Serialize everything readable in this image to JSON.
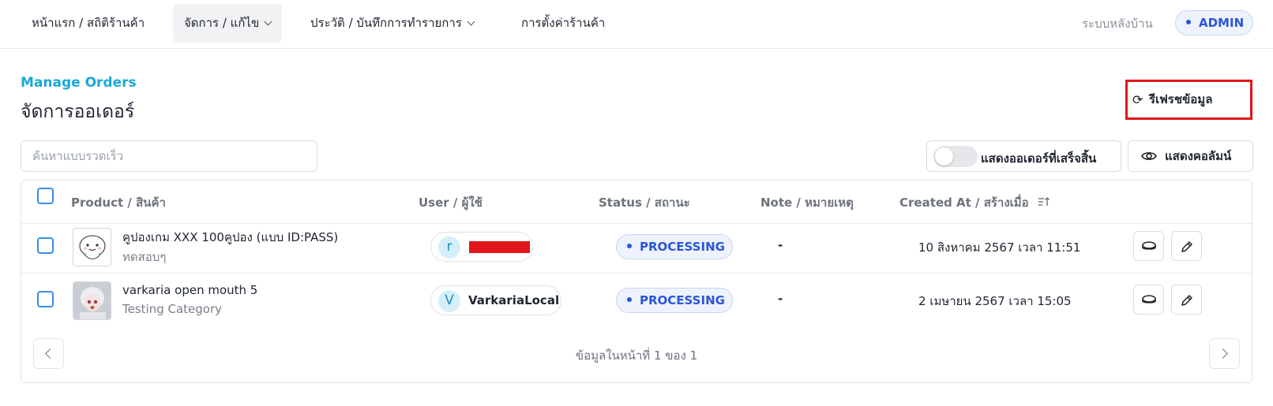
{
  "nav": {
    "home": "หน้าแรก / สถิติร้านค้า",
    "manage": "จัดการ / แก้ไข",
    "history": "ประวัติ / บันทึกการทำรายการ",
    "settings": "การตั้งค่าร้านค้า",
    "backend": "ระบบหลังบ้าน",
    "role": "ADMIN"
  },
  "page": {
    "title_en": "Manage Orders",
    "title_th": "จัดการออเดอร์",
    "refresh_label": "รีเฟรชข้อมูล",
    "search_placeholder": "ค้นหาแบบรวดเร็ว",
    "toggle_label": "แสดงออเดอร์ที่เสร็จสิ้น",
    "toggle_on": false,
    "columns_label": "แสดงคอลัมน์"
  },
  "table": {
    "headers": {
      "product": "Product / สินค้า",
      "user": "User / ผู้ใช้",
      "status": "Status / สถานะ",
      "note": "Note / หมายเหตุ",
      "created": "Created At / สร้างเมื่อ"
    },
    "rows": [
      {
        "product": "คูปองเกม XXX 100คูปอง (แบบ ID:PASS)",
        "category": "ทดสอบๆ",
        "user_initial": "r",
        "user_name": "",
        "user_redacted": true,
        "status": "PROCESSING",
        "note": "-",
        "created": "10 สิงหาคม 2567 เวลา 11:51"
      },
      {
        "product": "varkaria open mouth 5",
        "category": "Testing Category",
        "user_initial": "V",
        "user_name": "VarkariaLocal",
        "user_redacted": false,
        "status": "PROCESSING",
        "note": "-",
        "created": "2 เมษายน 2567 เวลา 15:05"
      }
    ],
    "pagination": "ข้อมูลในหน้าที่ 1 ของ 1"
  },
  "colors": {
    "accent": "#19a8d8",
    "status_blue": "#2a56d6",
    "highlight_red": "#e0161b"
  }
}
